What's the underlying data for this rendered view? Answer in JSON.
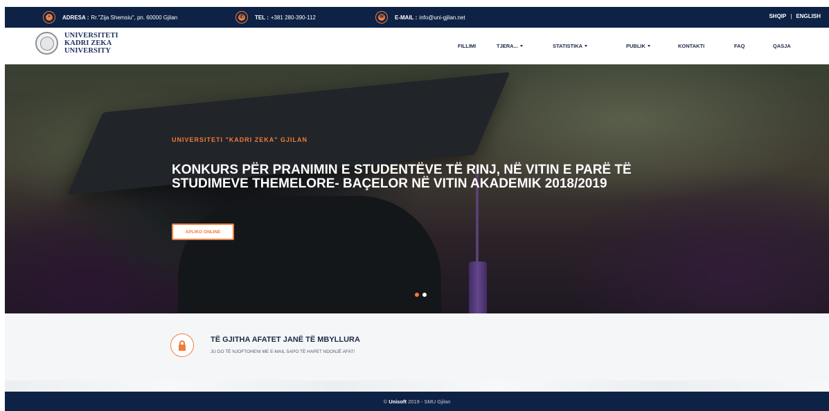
{
  "topbar": {
    "address_label": "ADRESA :",
    "address_value": "Rr.\"Zija Shemsiu\", pn. 60000 Gjilan",
    "phone_label": "TEL :",
    "phone_value": "+381 280-390-112",
    "email_label": "E-MAIL :",
    "email_value": "info@uni-gjilan.net",
    "lang_sq": "SHQIP",
    "lang_sep": "|",
    "lang_en": "ENGLISH"
  },
  "logo": {
    "line1": "UNIVERSITETI",
    "line2": "KADRI ZEKA",
    "line3": "UNIVERSITY"
  },
  "nav": {
    "items": [
      {
        "label": "FILLIMI"
      },
      {
        "label": "TJERA..."
      },
      {
        "label": "STATISTIKA"
      },
      {
        "label": "PUBLIK"
      },
      {
        "label": "KONTAKTI"
      },
      {
        "label": "FAQ"
      },
      {
        "label": "QASJA"
      }
    ]
  },
  "hero": {
    "subtitle": "UNIVERSITETI \"KADRI ZEKA\" GJILAN",
    "title": "KONKURS PËR PRANIMIN E STUDENTËVE TË RINJ, NË VITIN E PARË TË STUDIMEVE THEMELORE- BAÇELOR NË VITIN AKADEMIK 2018/2019",
    "button": "APLIKO ONLINE"
  },
  "notice": {
    "title": "TË GJITHA AFATET JANË TË MBYLLURA",
    "text": "JU DO TË NJOFTOHENI ME E-MAIL SAPO TË HAPET NDONJË AFAT!"
  },
  "footer": {
    "prefix": "©",
    "brand": "Unisoft",
    "suffix": "2019 - SMU Gjilan"
  },
  "colors": {
    "navy": "#0e2246",
    "accent": "#f07c3c"
  }
}
